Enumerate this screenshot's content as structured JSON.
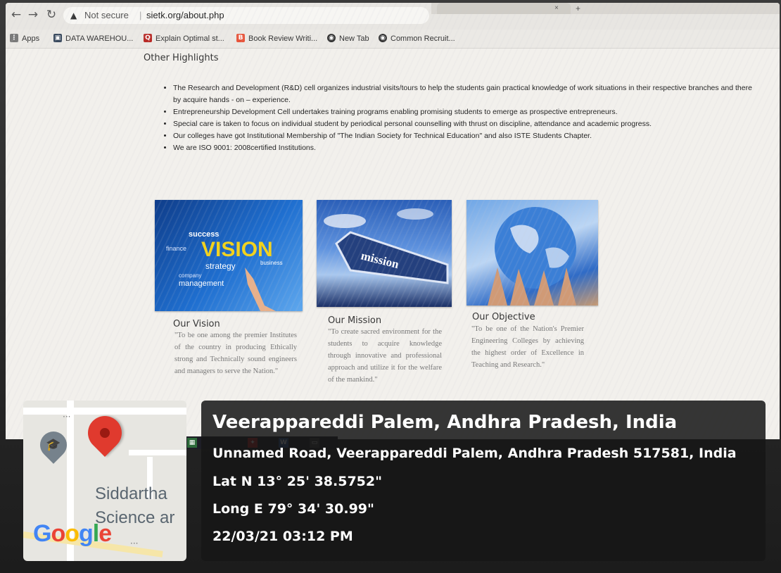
{
  "browser": {
    "security_label": "Not secure",
    "url": "sietk.org/about.php",
    "bookmarks": [
      "Apps",
      "DATA WAREHOU...",
      "Explain Optimal st...",
      "Book Review Writi...",
      "New Tab",
      "Common Recruit..."
    ]
  },
  "page": {
    "section_title": "Other Highlights",
    "highlights": [
      "The Research and Development (R&D) cell organizes industrial visits/tours to help the students gain practical knowledge of work situations in their respective branches and there by acquire hands - on – experience.",
      "Entrepreneurship Development Cell undertakes training programs enabling promising students to emerge as prospective entrepreneurs.",
      "Special care is taken to focus on individual student by periodical personal counselling with thrust on discipline, attendance and academic progress.",
      "Our colleges have got Institutional Membership of \"The Indian Society for Technical Education\" and also ISTE Students Chapter.",
      "We are ISO 9001: 2008certified Institutions."
    ],
    "cards": {
      "vision": {
        "title": "Our Vision",
        "text": "\"To be one among the premier Institutes of the country in producing Ethically strong and Technically sound engineers and managers to serve the Nation.\"",
        "image_words": [
          "VISION",
          "success",
          "finance",
          "business",
          "strategy",
          "management",
          "company"
        ]
      },
      "mission": {
        "title": "Our Mission",
        "text": "\"To create sacred environment for the students to acquire knowledge through innovative and professional approach and utilize it for the welfare of the mankind.\"",
        "image_word": "mission"
      },
      "objective": {
        "title": "Our Objective",
        "text": "\"To be one of the Nation's Premier Engineering Colleges by achieving the highest order of Excellence in Teaching and Research.\""
      }
    }
  },
  "overlay": {
    "map": {
      "label_line1": "Siddartha",
      "label_line2": "Science ar",
      "logo": "Google",
      "logo_colors": [
        "#4285F4",
        "#EA4335",
        "#FBBC05",
        "#4285F4",
        "#34A853",
        "#EA4335"
      ]
    },
    "place": "Veerappareddi Palem, Andhra Pradesh, India",
    "address": "Unnamed Road, Veerappareddi Palem, Andhra Pradesh 517581, India",
    "latitude": "Lat N 13° 25' 38.5752\"",
    "longitude": "Long E 79° 34' 30.99\"",
    "timestamp": "22/03/21 03:12 PM"
  }
}
